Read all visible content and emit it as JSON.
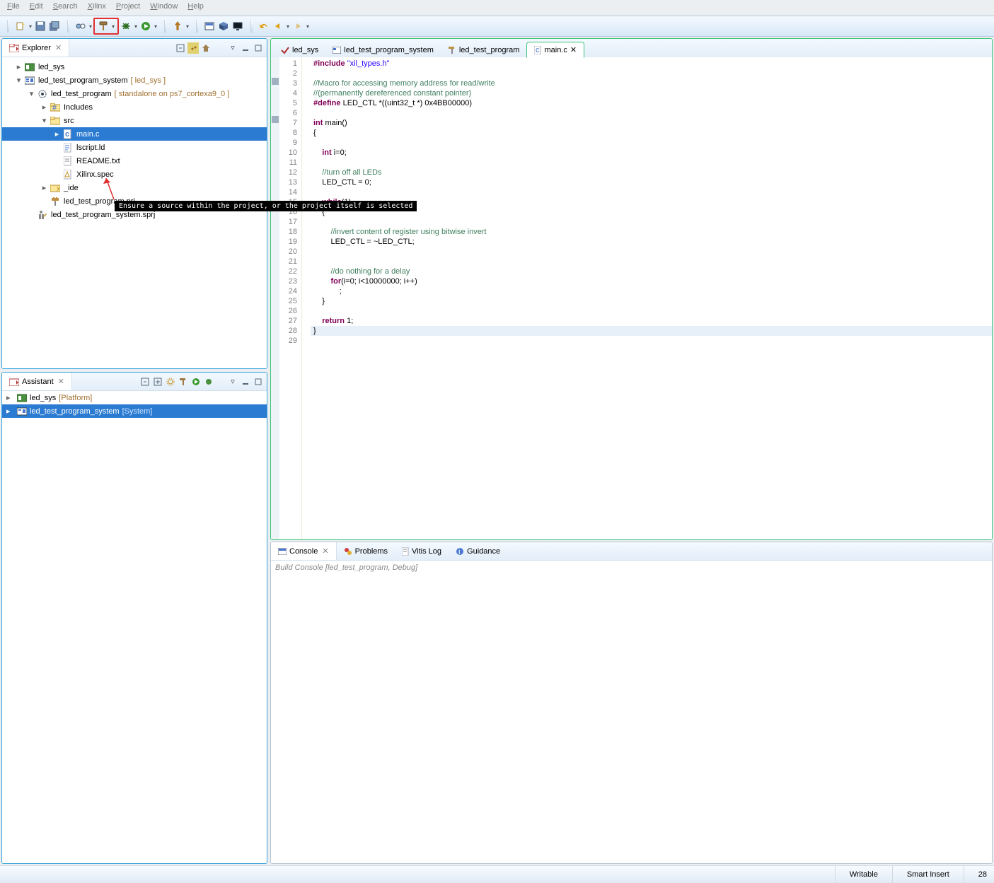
{
  "menu": {
    "file": "File",
    "edit": "Edit",
    "search": "Search",
    "xilinx": "Xilinx",
    "project": "Project",
    "window": "Window",
    "help": "Help"
  },
  "toolbar": {
    "new": "new",
    "save": "save",
    "saveall": "saveall",
    "perspective": "perspective",
    "build": "build",
    "debug": "debug",
    "run": "run",
    "pin": "pin",
    "terminal": "shell",
    "box": "box",
    "monitor": "monitor",
    "back": "back",
    "fwd": "fwd"
  },
  "explorer": {
    "title": "Explorer",
    "items": {
      "led_sys": "led_sys",
      "led_test_program_system": "led_test_program_system",
      "led_test_program_system_ctx": "[ led_sys ]",
      "led_test_program": "led_test_program",
      "led_test_program_ctx": "[ standalone on ps7_cortexa9_0 ]",
      "includes": "Includes",
      "src": "src",
      "main_c": "main.c",
      "lscript": "lscript.ld",
      "readme": "README.txt",
      "xilinx_spec": "Xilinx.spec",
      "ide": "_ide",
      "prj": "led_test_program.prj",
      "sprj": "led_test_program_system.sprj"
    }
  },
  "assistant": {
    "title": "Assistant",
    "led_sys": "led_sys",
    "led_sys_sub": "[Platform]",
    "system": "led_test_program_system",
    "system_sub": "[System]"
  },
  "editor": {
    "tabs": {
      "led_sys": "led_sys",
      "system": "led_test_program_system",
      "program": "led_test_program",
      "main_c": "main.c"
    },
    "lines": [
      "1",
      "2",
      "3",
      "4",
      "5",
      "6",
      "7",
      "8",
      "9",
      "10",
      "11",
      "12",
      "13",
      "14",
      "15",
      "16",
      "17",
      "18",
      "19",
      "20",
      "21",
      "22",
      "23",
      "24",
      "25",
      "26",
      "27",
      "28",
      "29"
    ]
  },
  "code": {
    "l1_a": "#include ",
    "l1_b": "\"xil_types.h\"",
    "l3": "//Macro for accessing memory address for read/write",
    "l4": "//(permanently dereferenced constant pointer)",
    "l5_a": "#define",
    "l5_b": " LED_CTL *((uint32_t *) 0x4BB00000)",
    "l7_a": "int",
    "l7_b": " main()",
    "l8": "{",
    "l10_a": "    int",
    "l10_b": " i=0;",
    "l12": "    //turn off all LEDs",
    "l13": "    LED_CTL = 0;",
    "l15_a": "    while",
    "l15_b": "(1)",
    "l16": "    {",
    "l18": "        //invert content of register using bitwise invert",
    "l19": "        LED_CTL = ~LED_CTL;",
    "l22": "        //do nothing for a delay",
    "l23_a": "        for",
    "l23_b": "(i=0; i<10000000; i++)",
    "l24": "            ;",
    "l25": "    }",
    "l27_a": "    return",
    "l27_b": " 1;",
    "l28": "}"
  },
  "console": {
    "tabs": {
      "console": "Console",
      "problems": "Problems",
      "vitislog": "Vitis Log",
      "guidance": "Guidance"
    },
    "text": "Build Console [led_test_program, Debug]"
  },
  "status": {
    "writable": "Writable",
    "insert": "Smart Insert",
    "pos": "28"
  },
  "tooltip": "Ensure a source within the project, or the project itself is selected"
}
